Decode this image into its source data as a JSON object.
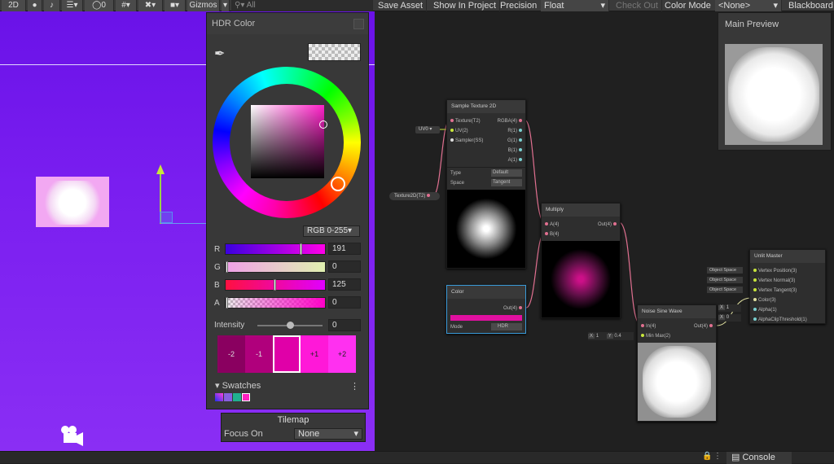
{
  "scene_toolbar": {
    "mode_2d": "2D",
    "hidden_count": "0",
    "gizmos": "Gizmos",
    "search_placeholder": "All"
  },
  "graph_toolbar": {
    "save_asset": "Save Asset",
    "show_in_project": "Show In Project",
    "precision_label": "Precision",
    "precision_value": "Float",
    "check_out": "Check Out",
    "color_mode_label": "Color Mode",
    "color_mode_value": "<None>",
    "blackboard": "Blackboard"
  },
  "hdr_color": {
    "title": "HDR Color",
    "color_mode": "RGB 0-255",
    "channels": [
      {
        "label": "R",
        "value": "191"
      },
      {
        "label": "G",
        "value": "0"
      },
      {
        "label": "B",
        "value": "125"
      },
      {
        "label": "A",
        "value": "0"
      }
    ],
    "intensity_label": "Intensity",
    "intensity_value": "0",
    "intensity_steps": [
      "-2",
      "-1",
      "+1",
      "+2"
    ],
    "swatches_label": "Swatches"
  },
  "tilemap": {
    "title": "Tilemap",
    "focus_on_label": "Focus On",
    "focus_on_value": "None"
  },
  "main_preview": {
    "title": "Main Preview"
  },
  "nodes": {
    "sample_texture": {
      "title": "Sample Texture 2D",
      "inputs": [
        "Texture(T2)",
        "UV(2)",
        "Sampler(SS)"
      ],
      "outputs": [
        "RGBA(4)",
        "R(1)",
        "G(1)",
        "B(1)",
        "A(1)"
      ],
      "type_label": "Type",
      "type_value": "Default",
      "space_label": "Space",
      "space_value": "Tangent",
      "uv_value": "UV0",
      "texture_prop": "Texture2D(T2)"
    },
    "multiply": {
      "title": "Multiply",
      "inputs": [
        "A(4)",
        "B(4)"
      ],
      "output": "Out(4)"
    },
    "color": {
      "title": "Color",
      "output": "Out(4)",
      "mode_label": "Mode",
      "mode_value": "HDR"
    },
    "noise_sine": {
      "title": "Noise Sine Wave",
      "inputs": [
        "In(4)",
        "Min Max(2)"
      ],
      "output": "Out(4)",
      "x_label": "X",
      "x_value": "1",
      "y_label": "Y",
      "y_value": "0.4"
    },
    "unlit_master": {
      "title": "Unlit Master",
      "inputs": [
        "Vertex Position(3)",
        "Vertex Normal(3)",
        "Vertex Tangent(3)",
        "Color(3)",
        "Alpha(1)",
        "AlphaClipThreshold(1)"
      ],
      "space_tags": [
        "Object Space",
        "Object Space",
        "Object Space"
      ],
      "alpha_x_label": "X",
      "alpha_value": "1",
      "clip_x_label": "X",
      "clip_value": "0"
    }
  },
  "bottom_bar": {
    "console": "Console"
  },
  "colors": {
    "picked": "#bf007d",
    "scene_bg": "#7a1ef0"
  }
}
